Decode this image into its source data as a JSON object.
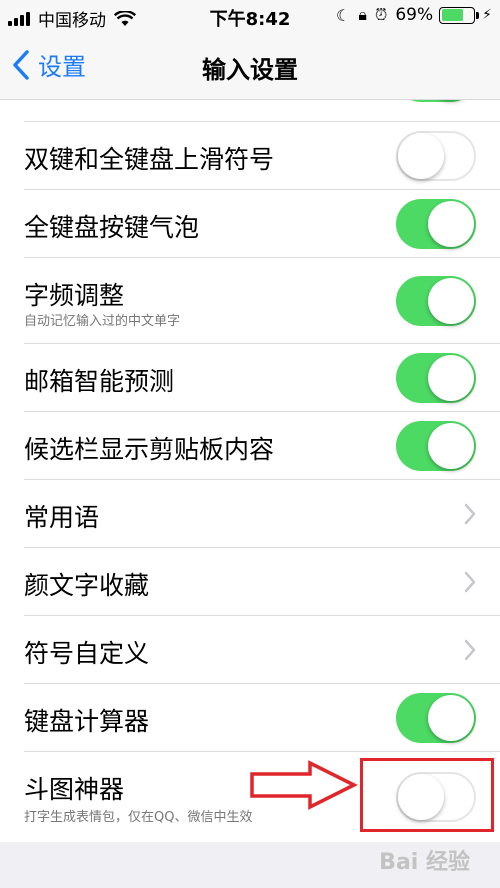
{
  "status_bar": {
    "carrier": "中国移动",
    "time": "下午8:42",
    "battery_percent": "69%",
    "battery_level": 0.69,
    "icons": [
      "signal-icon",
      "wifi-icon",
      "moon-icon",
      "rotation-lock-icon",
      "alarm-icon",
      "battery-icon",
      "charging-icon"
    ]
  },
  "nav": {
    "back_label": "设置",
    "title": "输入设置"
  },
  "settings": [
    {
      "label": "双键和全键盘上滑符号",
      "control": "toggle",
      "on": false
    },
    {
      "label": "全键盘按键气泡",
      "control": "toggle",
      "on": true
    },
    {
      "label": "字频调整",
      "sublabel": "自动记忆输入过的中文单字",
      "control": "toggle",
      "on": true
    },
    {
      "label": "邮箱智能预测",
      "control": "toggle",
      "on": true
    },
    {
      "label": "候选栏显示剪贴板内容",
      "control": "toggle",
      "on": true
    },
    {
      "label": "常用语",
      "control": "chevron"
    },
    {
      "label": "颜文字收藏",
      "control": "chevron"
    },
    {
      "label": "符号自定义",
      "control": "chevron"
    },
    {
      "label": "键盘计算器",
      "control": "toggle",
      "on": true
    },
    {
      "label": "斗图神器",
      "sublabel": "打字生成表情包，仅在QQ、微信中生效",
      "control": "toggle",
      "on": false
    }
  ],
  "watermark": "Bai 经验",
  "colors": {
    "accent": "#1b7cf7",
    "toggle_on": "#4cd964",
    "annotation": "#e0262b"
  }
}
